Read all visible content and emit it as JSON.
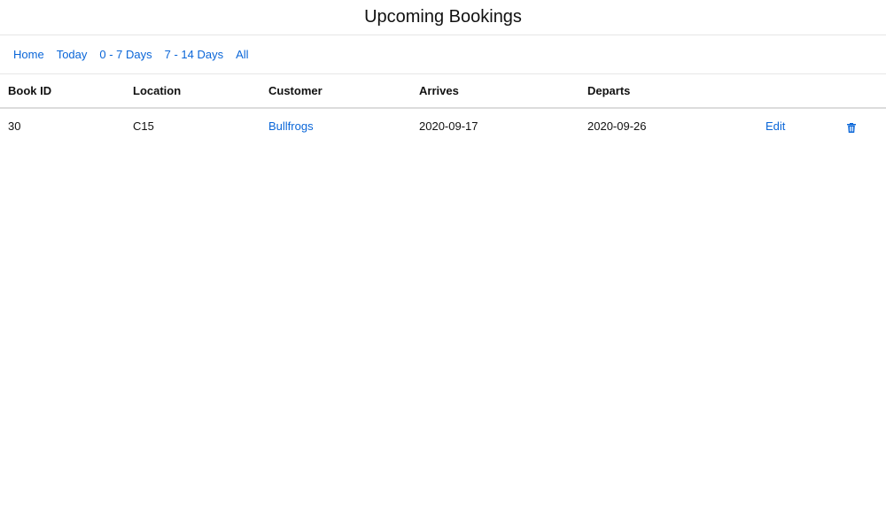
{
  "page": {
    "title": "Upcoming Bookings"
  },
  "nav": {
    "items": [
      {
        "label": "Home"
      },
      {
        "label": "Today"
      },
      {
        "label": "0 - 7 Days"
      },
      {
        "label": "7 - 14 Days"
      },
      {
        "label": "All"
      }
    ]
  },
  "table": {
    "headers": [
      "Book ID",
      "Location",
      "Customer",
      "Arrives",
      "Departs",
      "",
      ""
    ],
    "rows": [
      {
        "book_id": "30",
        "location": "C15",
        "customer": "Bullfrogs",
        "arrives": "2020-09-17",
        "departs": "2020-09-26",
        "edit_label": "Edit",
        "delete_icon": "trash-icon"
      }
    ]
  },
  "colors": {
    "link": "#0a66d8",
    "text": "#111111",
    "border": "#dcdcdc"
  }
}
